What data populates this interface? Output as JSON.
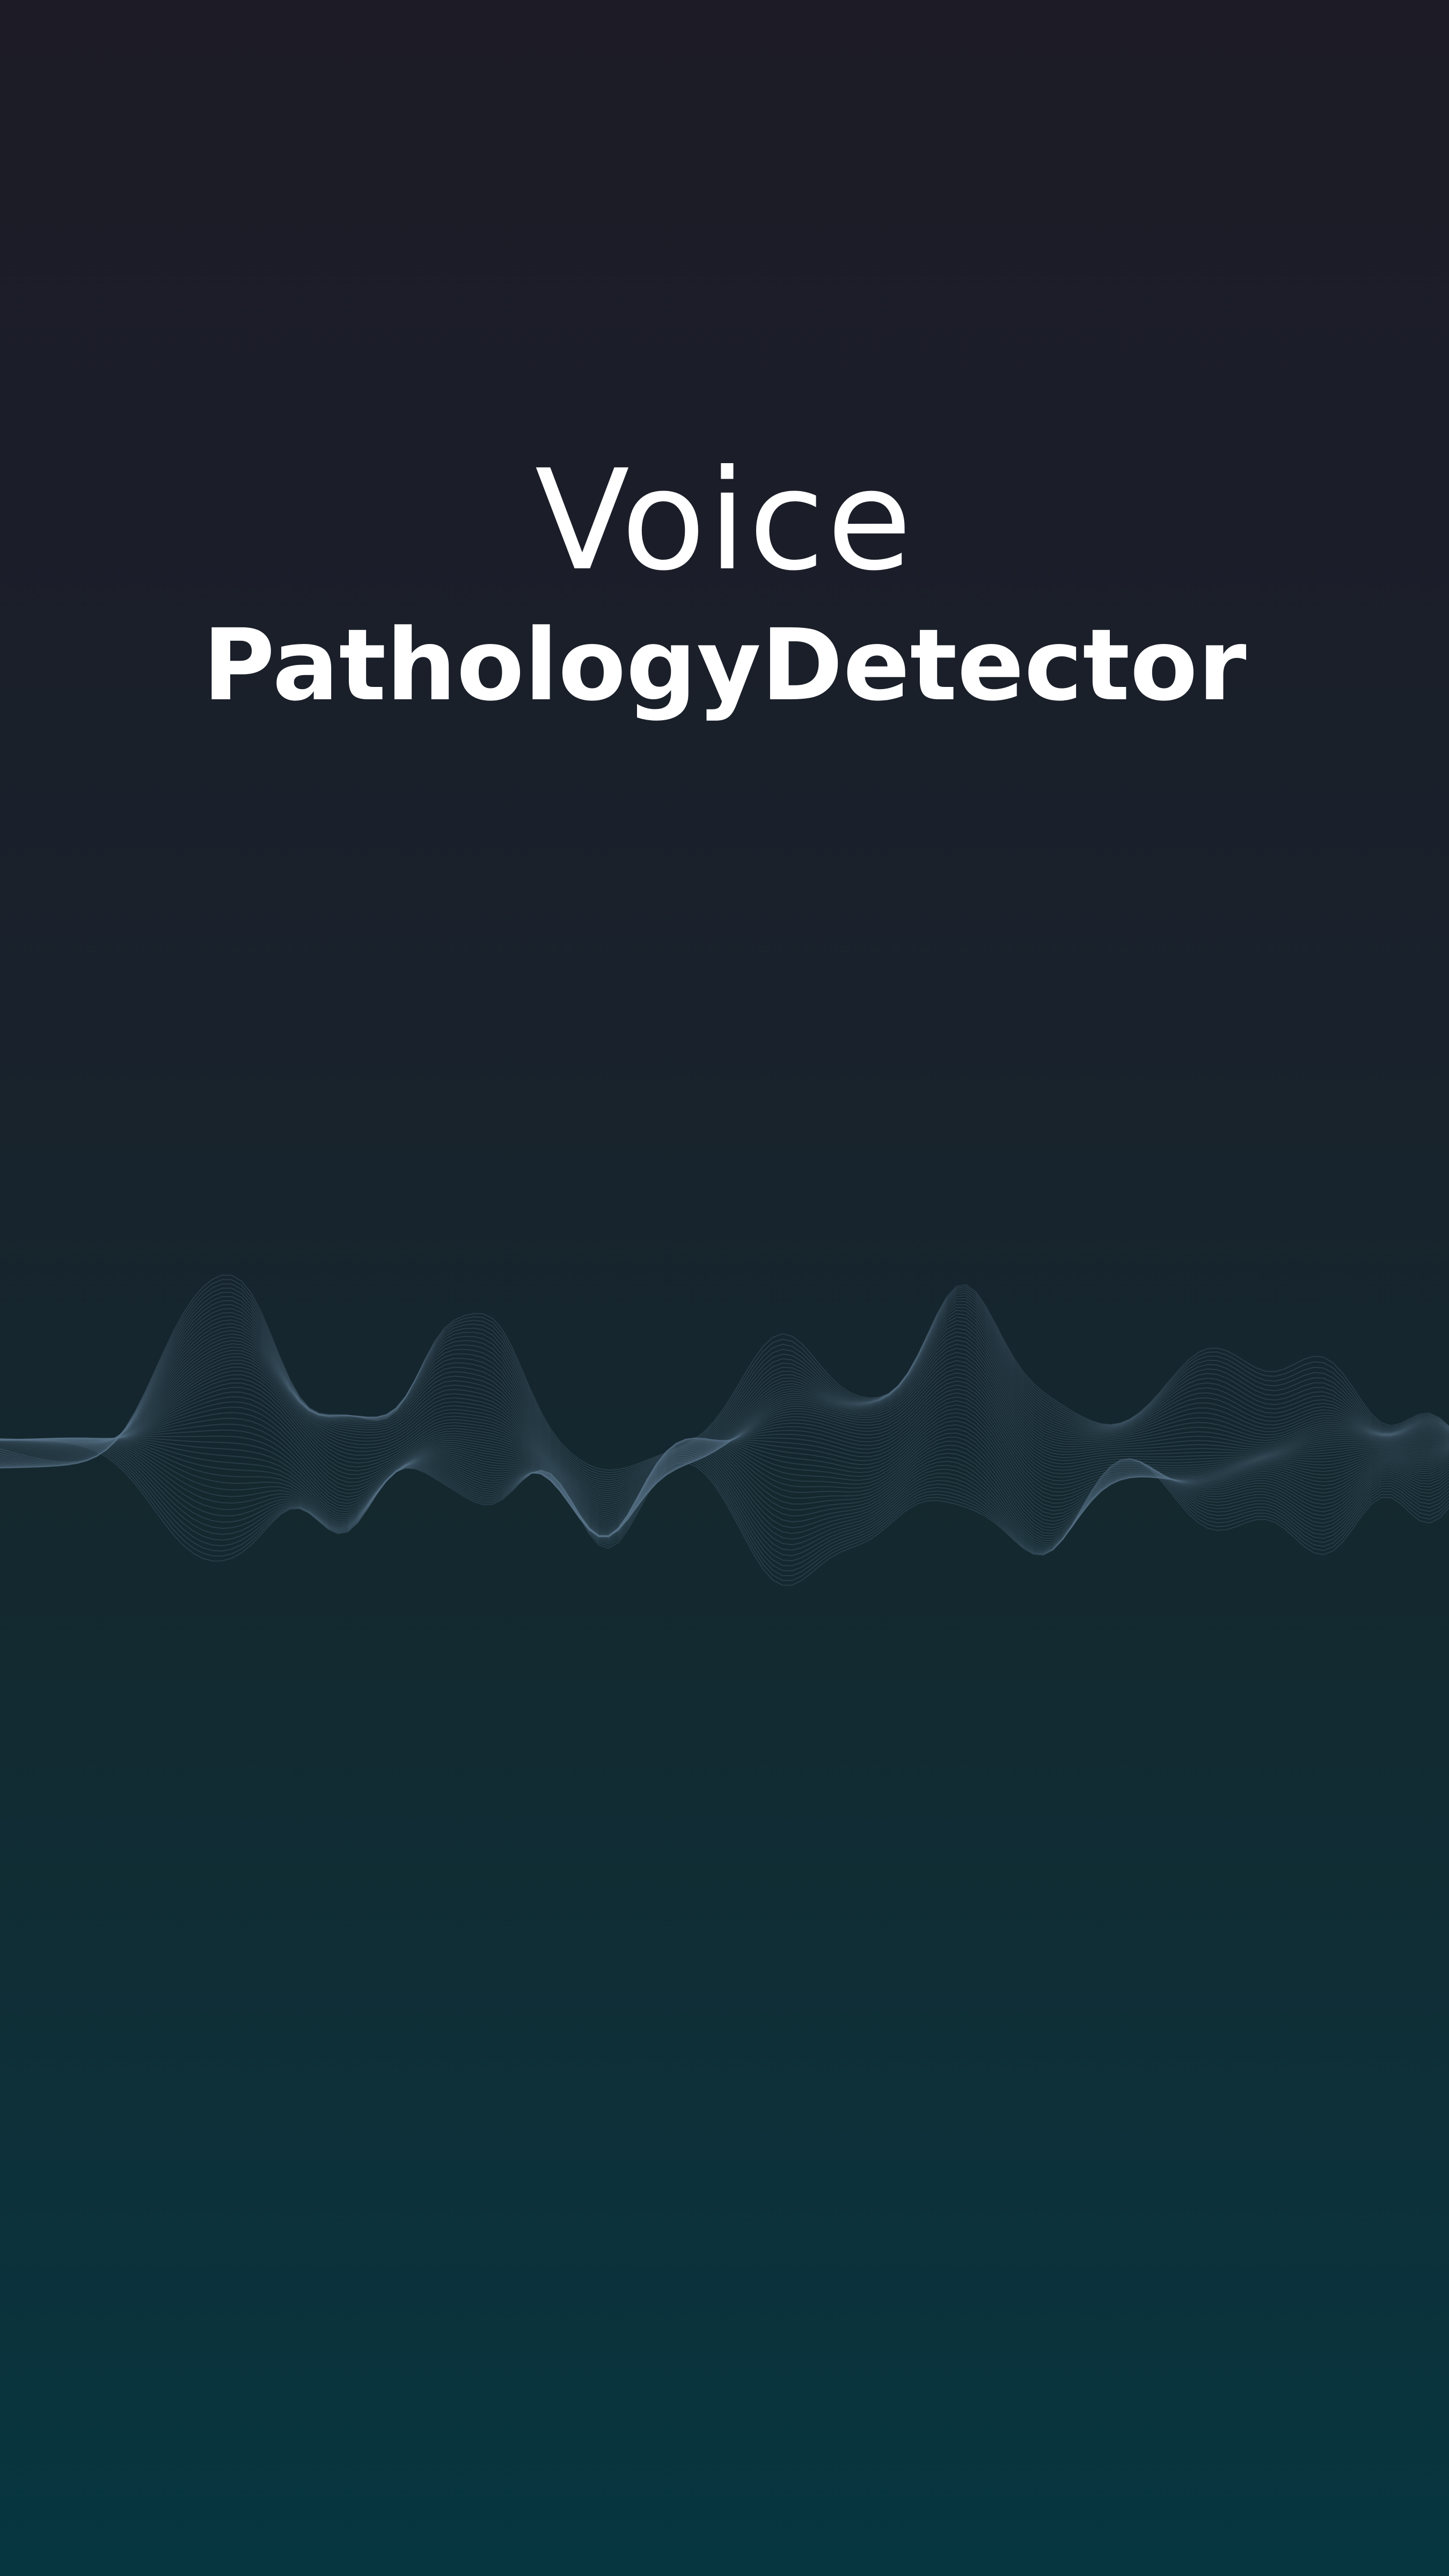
{
  "app": {
    "title_line1": "Voice",
    "title_line2": "PathologyDetector"
  },
  "colors": {
    "background_top": "#1c1b26",
    "background_bottom": "#063640",
    "title_text": "#ffffff",
    "waveform_stroke": "#5b7388"
  },
  "waveform": {
    "icon": "sound-wave-graphic"
  }
}
